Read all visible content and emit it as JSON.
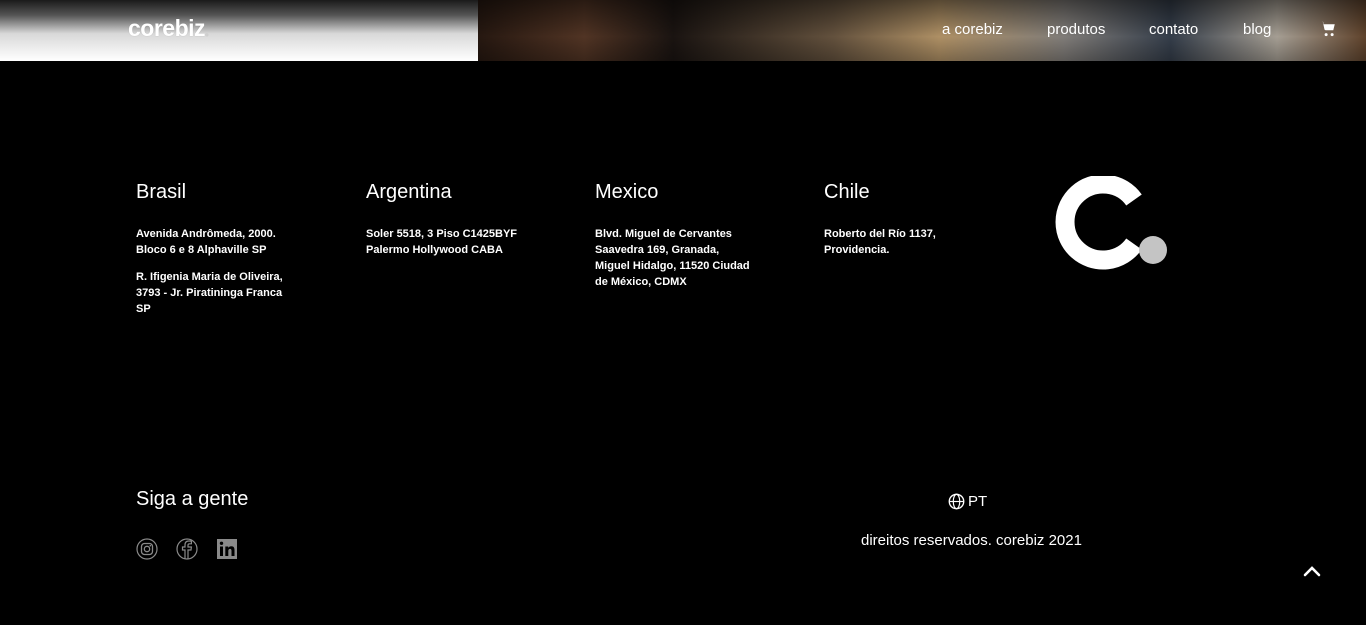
{
  "header": {
    "logo_text": "corebiz",
    "logo_dot": ".",
    "nav": [
      {
        "label": "a corebiz"
      },
      {
        "label": "produtos"
      },
      {
        "label": "contato"
      },
      {
        "label": "blog"
      }
    ],
    "cart_icon": "shopping-cart-icon"
  },
  "offices": [
    {
      "country": "Brasil",
      "addresses": [
        "Avenida Andrômeda, 2000. Bloco 6 e 8 Alphaville SP",
        "R. Ifigenia Maria de Oliveira, 3793 - Jr. Piratininga Franca SP"
      ]
    },
    {
      "country": "Argentina",
      "addresses": [
        "Soler 5518, 3 Piso C1425BYF Palermo Hollywood CABA"
      ]
    },
    {
      "country": "Mexico",
      "addresses": [
        "Blvd. Miguel de Cervantes Saavedra 169, Granada, Miguel Hidalgo, 11520 Ciudad de México, CDMX"
      ]
    },
    {
      "country": "Chile",
      "addresses": [
        "Roberto del Río 1137, Providencia."
      ]
    }
  ],
  "brand_mark": {
    "icon": "corebiz-c-logo-icon",
    "dot_color": "#c4c4c4"
  },
  "footer": {
    "follow_title": "Siga a gente",
    "social": [
      "instagram-icon",
      "facebook-icon",
      "linkedin-icon"
    ],
    "language": "PT",
    "language_icon": "globe-icon",
    "copyright": "direitos reservados. corebiz 2021",
    "back_to_top_icon": "chevron-up-icon"
  },
  "colors": {
    "background": "#000000",
    "text": "#ffffff",
    "icon_gray": "#8a8a8a"
  }
}
